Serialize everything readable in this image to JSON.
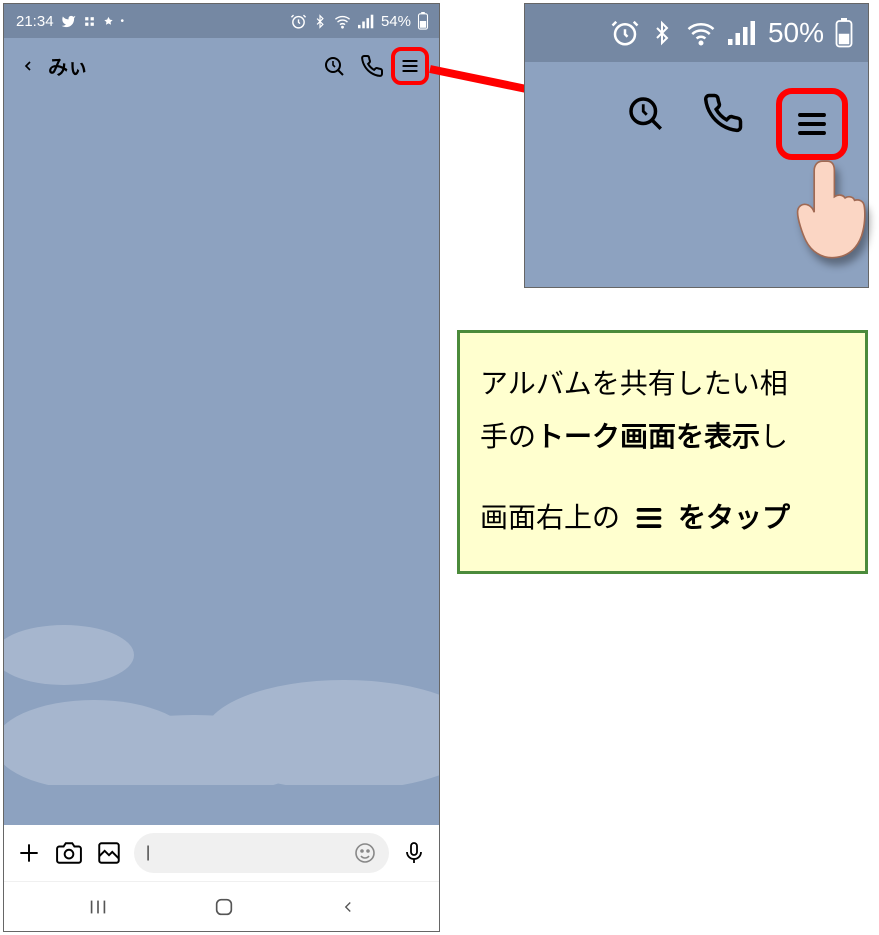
{
  "phone": {
    "status": {
      "time": "21:34",
      "battery_text": "54%"
    },
    "chat": {
      "contact_name": "みぃ"
    }
  },
  "zoom": {
    "battery_text": "50%"
  },
  "note": {
    "line1_a": "アルバムを共有したい相",
    "line1_b_prefix": "手の",
    "line1_b_bold": "トーク画面を表示",
    "line1_b_suffix": "し",
    "line2_prefix": "画面右上の",
    "line2_suffix": "をタップ"
  }
}
